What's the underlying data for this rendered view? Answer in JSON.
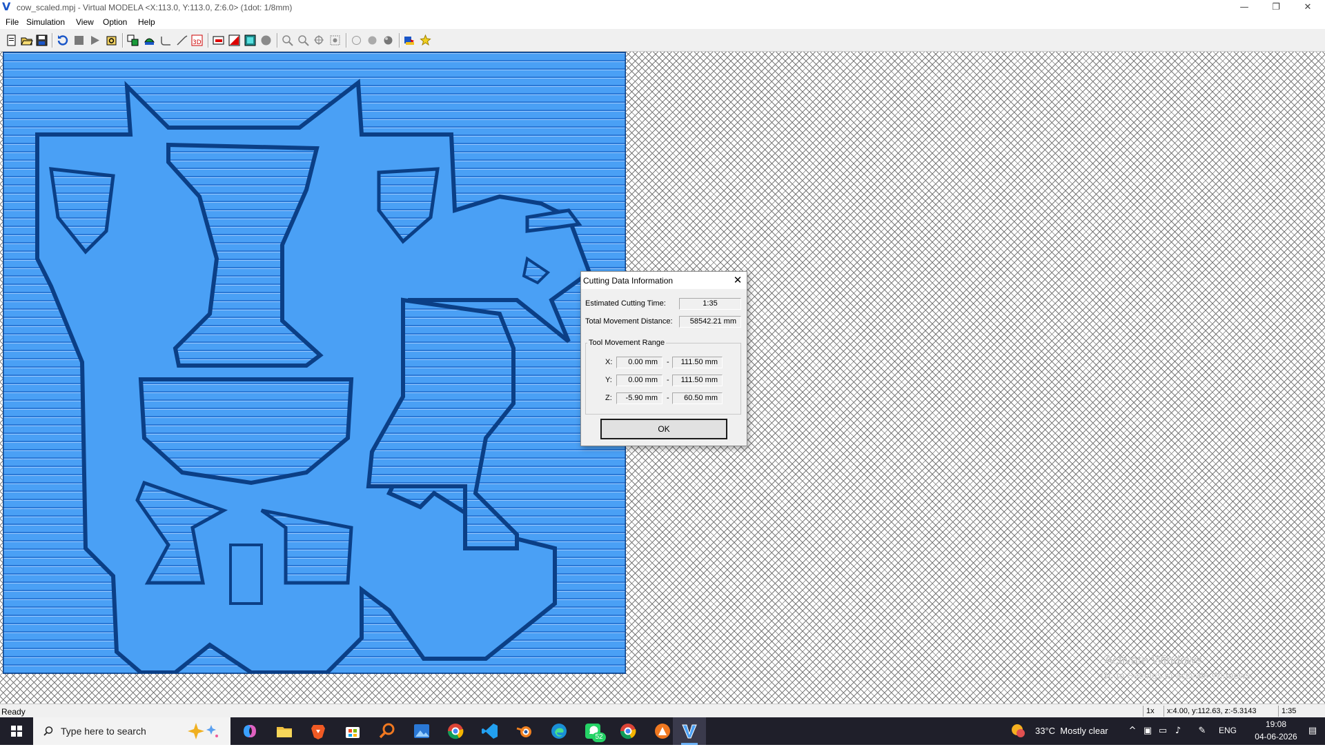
{
  "window": {
    "title": "cow_scaled.mpj - Virtual MODELA <X:113.0, Y:113.0, Z:6.0> (1dot: 1/8mm)",
    "minimize": "—",
    "maximize": "❐",
    "close": "✕"
  },
  "menu": {
    "items": [
      "File",
      "Simulation",
      "View",
      "Option",
      "Help"
    ]
  },
  "toolbar": {
    "icons": [
      "new-file-icon",
      "open-file-icon",
      "save-file-icon",
      "reload-icon",
      "stop-icon",
      "play-icon",
      "settings-icon",
      "view-top-icon",
      "view-front-icon",
      "path-icon",
      "path-alt-icon",
      "3d-view-icon",
      "red-bar-icon",
      "red-triangle-icon",
      "cyan-square-icon",
      "sphere-icon",
      "zoom-in-icon",
      "zoom-out-icon",
      "zoom-fit-icon",
      "zoom-window-icon",
      "light-1-icon",
      "light-2-icon",
      "light-3-icon",
      "material-icon",
      "star-icon"
    ]
  },
  "dialog": {
    "title": "Cutting Data Information",
    "estimated_time_label": "Estimated Cutting Time:",
    "estimated_time_value": "1:35",
    "distance_label": "Total Movement Distance:",
    "distance_value": "58542.21 mm",
    "range_title": "Tool Movement Range",
    "x_label": "X:",
    "x_min": "0.00 mm",
    "x_max": "111.50 mm",
    "y_label": "Y:",
    "y_min": "0.00 mm",
    "y_max": "111.50 mm",
    "z_label": "Z:",
    "z_min": "-5.90 mm",
    "z_max": "60.50 mm",
    "dash": "-",
    "ok_label": "OK"
  },
  "watermark": {
    "line1": "Activate Windows",
    "line2": "Go to Settings to activate Windows."
  },
  "statusbar": {
    "ready": "Ready",
    "zoom": "1x",
    "coords": "x:4.00, y:112.63, z:-5.3143",
    "time": "1:35"
  },
  "taskbar": {
    "search_placeholder": "Type here to search",
    "whatsapp_badge": "52",
    "weather_temp": "33°C",
    "weather_text": "Mostly clear",
    "lang": "ENG",
    "time": "19:08",
    "date": "04-06-2026"
  },
  "colors": {
    "workpiece_blue": "#4aa0f5",
    "groove_dark": "#0b3f86",
    "taskbar_bg": "#1f1f2a",
    "accent": "#1a56c8"
  }
}
